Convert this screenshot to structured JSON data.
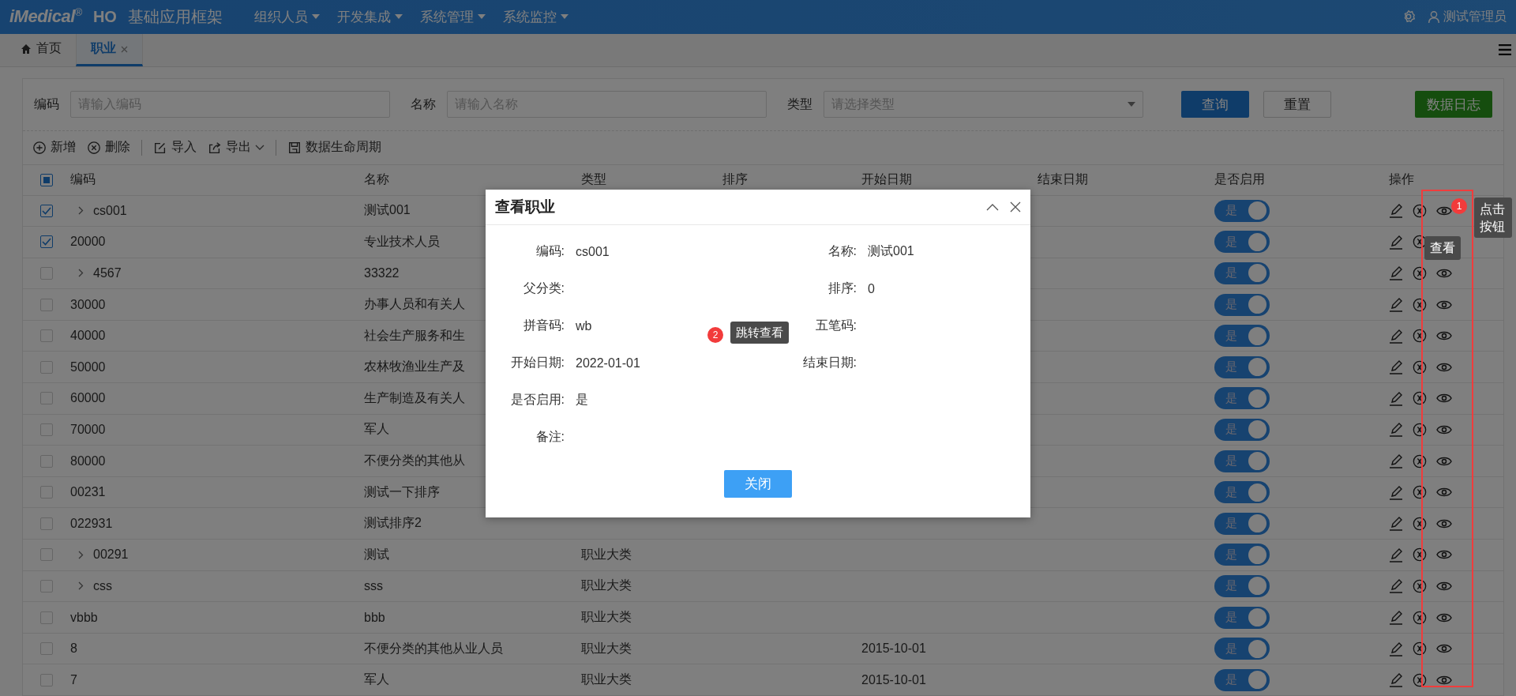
{
  "topbar": {
    "logo": "iMedical",
    "logo_mark": "®",
    "logo_suffix": "HO",
    "title": "基础应用框架",
    "menus": [
      "组织人员",
      "开发集成",
      "系统管理",
      "系统监控"
    ],
    "user": "测试管理员"
  },
  "tabs": [
    {
      "label": "首页",
      "kind": "home",
      "selected": false
    },
    {
      "label": "职业",
      "kind": "closable",
      "selected": true
    }
  ],
  "filters": [
    {
      "label": "编码",
      "placeholder": "请输入编码",
      "kind": "input"
    },
    {
      "label": "名称",
      "placeholder": "请输入名称",
      "kind": "input"
    },
    {
      "label": "类型",
      "placeholder": "请选择类型",
      "kind": "select"
    }
  ],
  "filter_buttons": [
    {
      "label": "查询",
      "kind": "primary"
    },
    {
      "label": "重置",
      "kind": "default"
    }
  ],
  "log_button": "数据日志",
  "toolbar": [
    {
      "label": "新增",
      "kind": "add"
    },
    {
      "label": "删除",
      "kind": "delete"
    },
    {
      "kind": "sep"
    },
    {
      "label": "导入",
      "kind": "import"
    },
    {
      "label": "导出",
      "kind": "export"
    },
    {
      "kind": "sep"
    },
    {
      "label": "数据生命周期",
      "kind": "lifecycle"
    }
  ],
  "table": {
    "header_partial": true,
    "columns": [
      "编码",
      "名称",
      "类型",
      "排序",
      "开始日期",
      "结束日期",
      "是否启用",
      "操作"
    ],
    "rows": [
      {
        "code": "cs001",
        "expandable": true,
        "name": "测试001",
        "checked": true,
        "enabled": true,
        "enabled_label": "是"
      },
      {
        "code": "20000",
        "expandable": false,
        "name": "专业技术人员",
        "view_covered": true,
        "checked": true,
        "enabled": true,
        "enabled_label": "是"
      },
      {
        "code": "4567",
        "expandable": true,
        "name": "33322",
        "checked": false,
        "enabled": true,
        "enabled_label": "是"
      },
      {
        "code": "30000",
        "expandable": false,
        "name": "办事人员和有关人",
        "checked": false,
        "enabled": true,
        "enabled_label": "是"
      },
      {
        "code": "40000",
        "expandable": false,
        "name": "社会生产服务和生",
        "checked": false,
        "enabled": true,
        "enabled_label": "是"
      },
      {
        "code": "50000",
        "expandable": false,
        "name": "农林牧渔业生产及",
        "checked": false,
        "enabled": true,
        "enabled_label": "是"
      },
      {
        "code": "60000",
        "expandable": false,
        "name": "生产制造及有关人",
        "checked": false,
        "enabled": true,
        "enabled_label": "是"
      },
      {
        "code": "70000",
        "expandable": false,
        "name": "军人",
        "checked": false,
        "enabled": true,
        "enabled_label": "是"
      },
      {
        "code": "80000",
        "expandable": false,
        "name": "不便分类的其他从",
        "checked": false,
        "enabled": true,
        "enabled_label": "是"
      },
      {
        "code": "00231",
        "expandable": false,
        "name": "测试一下排序",
        "checked": false,
        "enabled": true,
        "enabled_label": "是"
      },
      {
        "code": "022931",
        "expandable": false,
        "name": "测试排序2",
        "checked": false,
        "enabled": true,
        "enabled_label": "是"
      },
      {
        "code": "00291",
        "expandable": true,
        "name": "测试",
        "type": "职业大类",
        "checked": false,
        "enabled": true,
        "enabled_label": "是"
      },
      {
        "code": "css",
        "expandable": true,
        "name": "sss",
        "type": "职业大类",
        "checked": false,
        "enabled": true,
        "enabled_label": "是"
      },
      {
        "code": "vbbb",
        "expandable": false,
        "name": "bbb",
        "type": "职业大类",
        "checked": false,
        "enabled": true,
        "enabled_label": "是"
      },
      {
        "code": "8",
        "expandable": false,
        "name": "不便分类的其他从业人员",
        "type": "职业大类",
        "start": "2015-10-01",
        "checked": false,
        "enabled": true,
        "enabled_label": "是"
      },
      {
        "code": "7",
        "expandable": false,
        "name": "军人",
        "type": "职业大类",
        "start": "2015-10-01",
        "checked": false,
        "enabled": true,
        "enabled_label": "是"
      }
    ]
  },
  "dialog": {
    "title": "查看职业",
    "rows": [
      [
        {
          "label": "编码:",
          "value": "cs001"
        },
        {
          "label": "名称:",
          "value": "测试001"
        }
      ],
      [
        {
          "label": "父分类:"
        },
        {
          "label": "排序:",
          "value": "0"
        }
      ],
      [
        {
          "label": "拼音码:",
          "value": "wb"
        },
        {
          "label": "五笔码:"
        }
      ],
      [
        {
          "label": "开始日期:",
          "value": "2022-01-01"
        },
        {
          "label": "结束日期:"
        }
      ],
      [
        {
          "label": "是否启用:",
          "value": "是"
        }
      ],
      [
        {
          "label": "备注:"
        }
      ]
    ],
    "close_button": "关闭"
  },
  "annotations": [
    {
      "number": "1",
      "tip": "点击按钮",
      "tip2": "查看"
    },
    {
      "number": "2",
      "tip": "跳转查看"
    }
  ]
}
